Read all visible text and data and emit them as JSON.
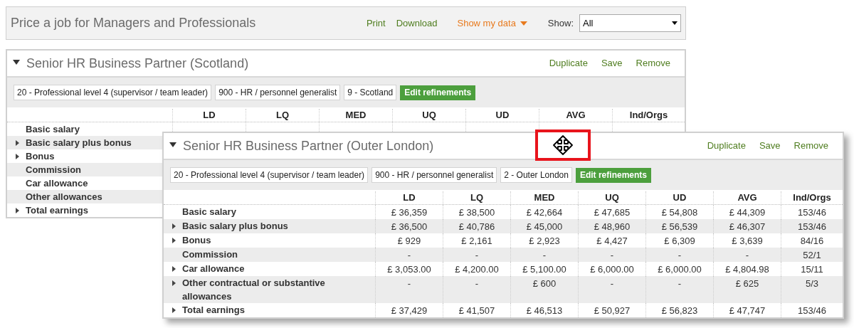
{
  "header": {
    "title": "Price a job for Managers and Professionals",
    "links": [
      {
        "label": "Print",
        "kind": "link"
      },
      {
        "label": "Download",
        "kind": "link"
      },
      {
        "label": "Show my data",
        "kind": "menu"
      }
    ],
    "show": {
      "label": "Show:",
      "value": "All"
    }
  },
  "jobs": [
    {
      "title": "Senior HR Business Partner (Scotland)",
      "expanded": true,
      "actions": [
        "Duplicate",
        "Save",
        "Remove"
      ],
      "refinements": [
        "20 - Professional level 4 (supervisor / team leader)",
        "900 - HR / personnel generalist",
        "9 - Scotland"
      ],
      "edit_button": "Edit refinements",
      "columns": [
        "LD",
        "LQ",
        "MED",
        "UQ",
        "UD",
        "AVG",
        "Ind/Orgs"
      ],
      "rows": [
        {
          "label": "Basic salary",
          "expandable": false
        },
        {
          "label": "Basic salary plus bonus",
          "expandable": true
        },
        {
          "label": "Bonus",
          "expandable": true
        },
        {
          "label": "Commission",
          "expandable": false
        },
        {
          "label": "Car allowance",
          "expandable": false
        },
        {
          "label": "Other allowances",
          "expandable": false
        },
        {
          "label": "Total earnings",
          "expandable": true
        }
      ]
    },
    {
      "title": "Senior HR Business Partner (Outer London)",
      "expanded": true,
      "actions": [
        "Duplicate",
        "Save",
        "Remove"
      ],
      "refinements": [
        "20 - Professional level 4 (supervisor / team leader)",
        "900 - HR / personnel generalist",
        "2 - Outer London"
      ],
      "edit_button": "Edit refinements",
      "columns": [
        "LD",
        "LQ",
        "MED",
        "UQ",
        "UD",
        "AVG",
        "Ind/Orgs"
      ],
      "rows": [
        {
          "label": "Basic salary",
          "expandable": false,
          "values": [
            "£ 36,359",
            "£ 38,500",
            "£ 42,664",
            "£ 47,685",
            "£ 54,808",
            "£ 44,309",
            "153/46"
          ]
        },
        {
          "label": "Basic salary plus bonus",
          "expandable": true,
          "values": [
            "£ 36,500",
            "£ 40,786",
            "£ 45,000",
            "£ 48,960",
            "£ 56,539",
            "£ 46,307",
            "153/46"
          ]
        },
        {
          "label": "Bonus",
          "expandable": true,
          "values": [
            "£ 929",
            "£ 2,161",
            "£ 2,923",
            "£ 4,427",
            "£ 6,309",
            "£ 3,639",
            "84/16"
          ]
        },
        {
          "label": "Commission",
          "expandable": false,
          "values": [
            "-",
            "-",
            "-",
            "-",
            "-",
            "-",
            "52/1"
          ]
        },
        {
          "label": "Car allowance",
          "expandable": true,
          "values": [
            "£ 3,053.00",
            "£ 4,200.00",
            "£ 5,100.00",
            "£ 6,000.00",
            "£ 6,000.00",
            "£ 4,804.98",
            "15/11"
          ]
        },
        {
          "label": "Other contractual or substantive allowances",
          "expandable": true,
          "values": [
            "-",
            "-",
            "£ 600",
            "-",
            "-",
            "£ 625",
            "5/3"
          ]
        },
        {
          "label": "Total earnings",
          "expandable": true,
          "values": [
            "£ 37,429",
            "£ 41,507",
            "£ 46,513",
            "£ 50,927",
            "£ 56,823",
            "£ 47,747",
            "153/46"
          ]
        }
      ]
    }
  ]
}
